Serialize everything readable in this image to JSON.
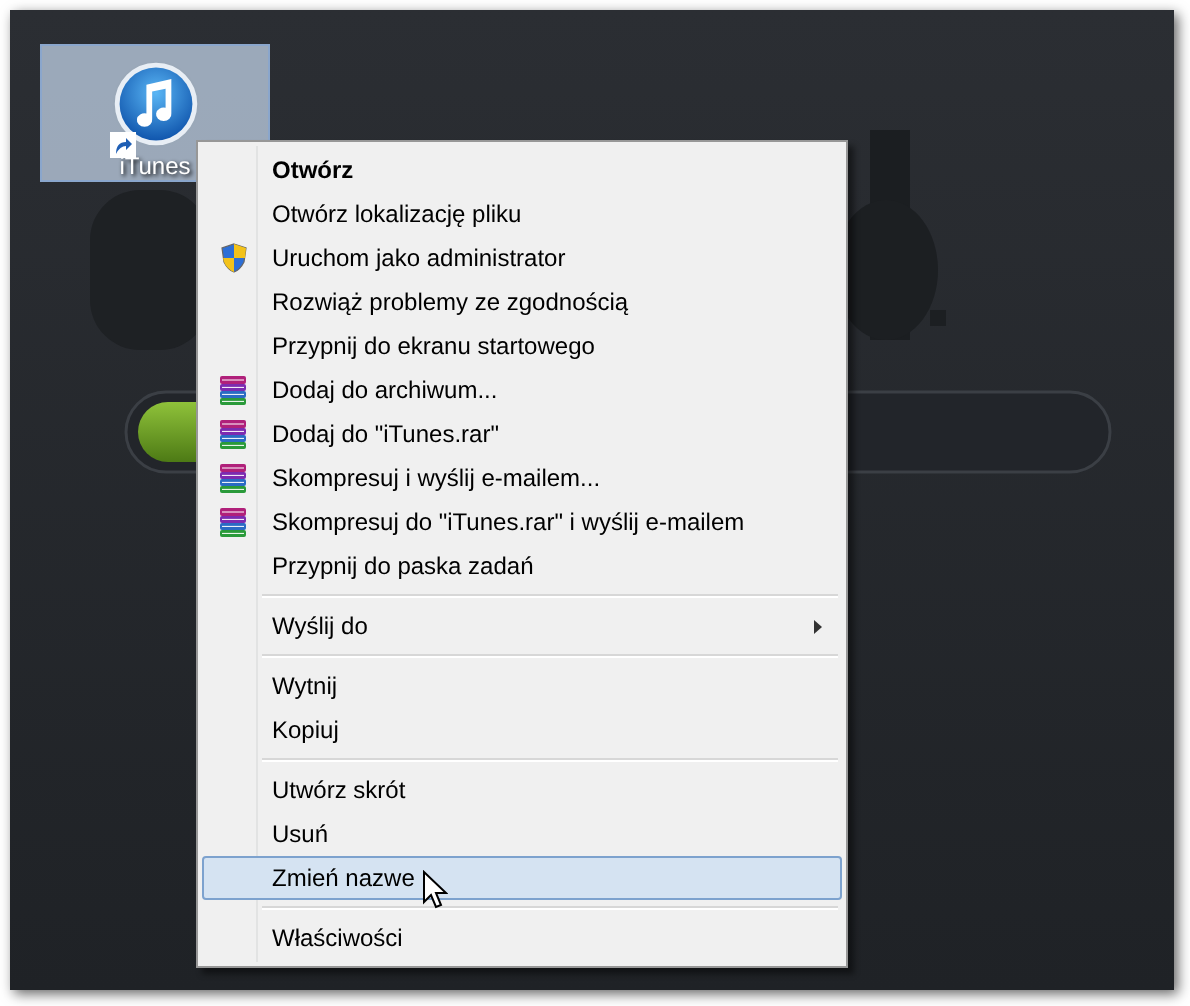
{
  "desktop_icon": {
    "label": "iTunes",
    "selected": true
  },
  "context_menu": {
    "items": [
      {
        "kind": "default",
        "label": "Otwórz",
        "selected": false
      },
      {
        "kind": "plain",
        "label": "Otwórz lokalizację pliku",
        "selected": false
      },
      {
        "kind": "shield",
        "label": "Uruchom jako administrator",
        "selected": false
      },
      {
        "kind": "plain",
        "label": "Rozwiąż problemy ze zgodnością",
        "selected": false
      },
      {
        "kind": "plain",
        "label": "Przypnij do ekranu startowego",
        "selected": false
      },
      {
        "kind": "archive",
        "label": "Dodaj do archiwum...",
        "selected": false
      },
      {
        "kind": "archive",
        "label": "Dodaj do \"iTunes.rar\"",
        "selected": false
      },
      {
        "kind": "archive",
        "label": "Skompresuj i wyślij e-mailem...",
        "selected": false
      },
      {
        "kind": "archive",
        "label": "Skompresuj do \"iTunes.rar\" i wyślij e-mailem",
        "selected": false
      },
      {
        "kind": "plain",
        "label": "Przypnij do paska zadań",
        "selected": false
      },
      {
        "kind": "separator"
      },
      {
        "kind": "submenu",
        "label": "Wyślij do",
        "selected": false
      },
      {
        "kind": "separator"
      },
      {
        "kind": "plain",
        "label": "Wytnij",
        "selected": false
      },
      {
        "kind": "plain",
        "label": "Kopiuj",
        "selected": false
      },
      {
        "kind": "separator"
      },
      {
        "kind": "plain",
        "label": "Utwórz skrót",
        "selected": false
      },
      {
        "kind": "plain",
        "label": "Usuń",
        "selected": false
      },
      {
        "kind": "plain",
        "label": "Zmień nazwe",
        "selected": true
      },
      {
        "kind": "separator"
      },
      {
        "kind": "plain",
        "label": "Właściwości",
        "selected": false
      }
    ]
  }
}
